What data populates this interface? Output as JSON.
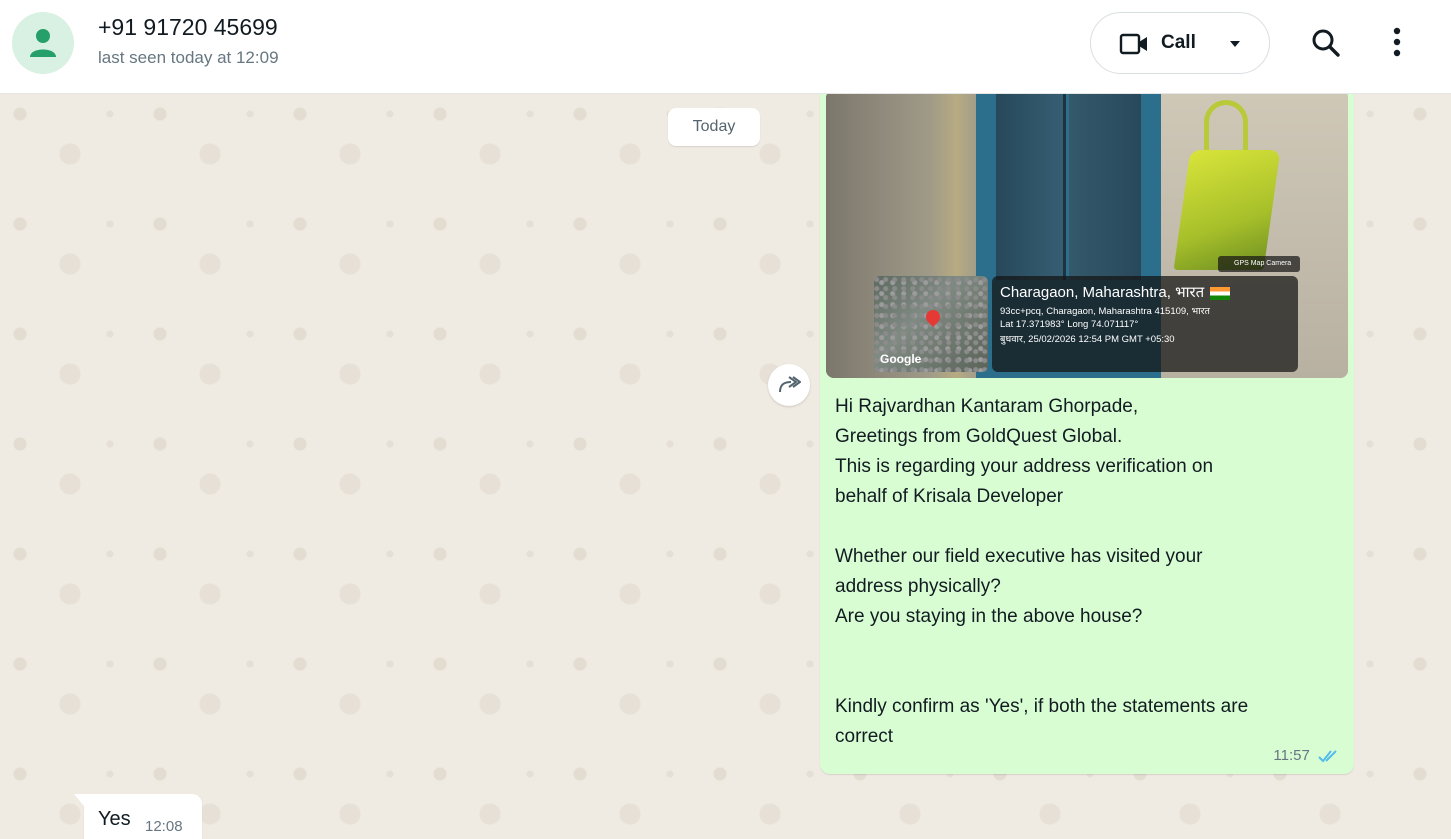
{
  "header": {
    "contact_name": "+91 91720 45699",
    "status": "last seen today at 12:09",
    "call_label": "Call",
    "icons": {
      "avatar": "person-icon",
      "call": "video-camera-icon",
      "dropdown": "caret-down-icon",
      "search": "search-icon",
      "menu": "kebab-menu-icon"
    },
    "colors": {
      "avatar_bg": "#d8f1e2",
      "avatar_fg": "#25a06a"
    }
  },
  "chat": {
    "date_divider": "Today",
    "forward_icon": "forward-icon",
    "outgoing": {
      "image": {
        "geo_title": "Charagaon, Maharashtra, भारत",
        "geo_address": "93cc+pcq, Charagaon, Maharashtra 415109, भारत",
        "geo_coords": "Lat 17.371983° Long 74.071117°",
        "geo_datetime": "बुधवार, 25/02/2026 12:54 PM GMT +05:30",
        "map_brand": "Google",
        "camera_tag": "GPS Map Camera"
      },
      "lines": {
        "l1": "Hi Rajvardhan Kantaram Ghorpade,",
        "l2": "Greetings from GoldQuest Global.",
        "l3": "This is regarding your address verification on",
        "l4": "behalf of Krisala Developer",
        "l5": "Whether our field executive has visited your",
        "l6": "address physically?",
        "l7": "Are you staying in the above house?",
        "l8": "Kindly confirm as 'Yes', if both the statements are",
        "l9": "correct"
      },
      "time": "11:57",
      "status_icon": "double-check-read-icon",
      "bubble_color": "#d9fdd3"
    },
    "incoming": {
      "text": "Yes",
      "time": "12:08",
      "bubble_color": "#ffffff"
    }
  }
}
